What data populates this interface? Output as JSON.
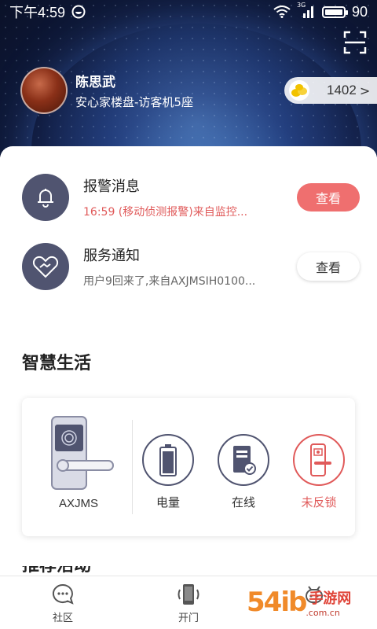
{
  "status_bar": {
    "time": "下午4:59",
    "network": "3G",
    "battery": "90"
  },
  "profile": {
    "name": "陈思武",
    "address": "安心家楼盘-访客机5座"
  },
  "coins": {
    "value": "1402",
    "chevron": ">"
  },
  "messages": [
    {
      "title": "报警消息",
      "subtitle": "16:59 (移动侦测报警)来自监控...",
      "button": "查看",
      "icon": "bell-icon"
    },
    {
      "title": "服务通知",
      "subtitle": "用户9回来了,来自AXJMSIH0100...",
      "button": "查看",
      "icon": "handshake-heart-icon"
    }
  ],
  "section_title": "智慧生活",
  "device": {
    "name": "AXJMS",
    "stats": [
      {
        "label": "电量",
        "icon": "battery-icon"
      },
      {
        "label": "在线",
        "icon": "server-check-icon"
      },
      {
        "label": "未反锁",
        "icon": "door-lock-icon"
      }
    ]
  },
  "next_section_title": "推荐活动",
  "bottom_nav": [
    {
      "label": "社区",
      "icon": "chat-bubble-icon"
    },
    {
      "label": "开门",
      "icon": "phone-open-icon"
    },
    {
      "label": "",
      "icon": "robot-icon"
    }
  ],
  "watermark": {
    "number": "54ib",
    "text": "手游网",
    "sub": ".com.cn"
  },
  "colors": {
    "accent_red": "#ef6f6f",
    "icon_dark": "#505470",
    "header_dark": "#0e1838"
  }
}
